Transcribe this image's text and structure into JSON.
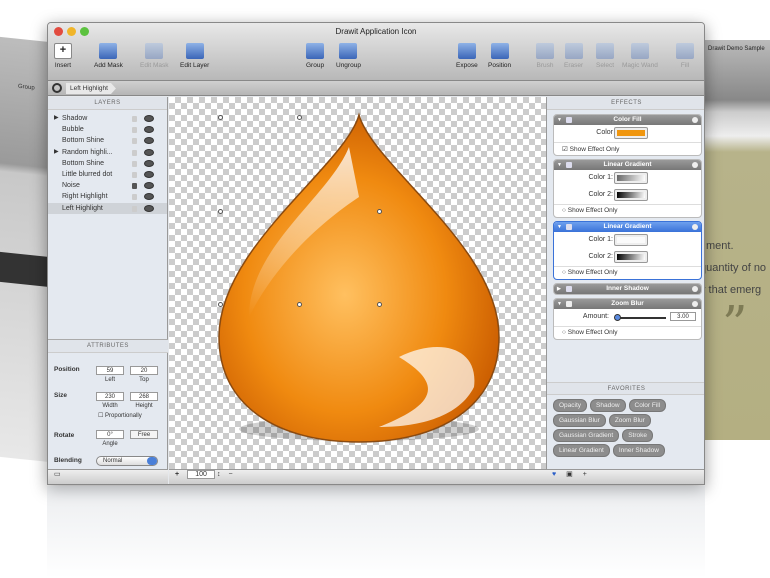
{
  "background_left": {
    "label": "Group"
  },
  "background_right": {
    "title": "Drawit Demo Sample",
    "lines": [
      "ment.",
      "quantity of no",
      "y that emerg"
    ],
    "quote": "”"
  },
  "window": {
    "title": "Drawit Application Icon"
  },
  "toolbar": [
    {
      "label": "Insert",
      "enabled": true
    },
    {
      "label": "Add Mask",
      "enabled": true
    },
    {
      "label": "Edit Mask",
      "enabled": false
    },
    {
      "label": "Edit Layer",
      "enabled": true
    },
    {
      "label": "Group",
      "enabled": true
    },
    {
      "label": "Ungroup",
      "enabled": true
    },
    {
      "label": "Expose",
      "enabled": true
    },
    {
      "label": "Position",
      "enabled": true
    },
    {
      "label": "Brush",
      "enabled": false
    },
    {
      "label": "Eraser",
      "enabled": false
    },
    {
      "label": "Select",
      "enabled": false
    },
    {
      "label": "Magic Wand",
      "enabled": false
    },
    {
      "label": "Fill",
      "enabled": false
    }
  ],
  "breadcrumb": "Left Highlight",
  "layers": {
    "title": "LAYERS",
    "items": [
      {
        "name": "Shadow",
        "group": true,
        "locked": false
      },
      {
        "name": "Bubble",
        "locked": false
      },
      {
        "name": "Bottom Shine",
        "locked": false
      },
      {
        "name": "Random highli...",
        "group": true,
        "locked": false
      },
      {
        "name": "Bottom Shine",
        "locked": false
      },
      {
        "name": "Little blurred dot",
        "locked": false
      },
      {
        "name": "Noise",
        "locked": true
      },
      {
        "name": "Right Highlight",
        "locked": false
      },
      {
        "name": "Left Highlight",
        "locked": false,
        "selected": true
      }
    ]
  },
  "attributes": {
    "title": "ATTRIBUTES",
    "position_label": "Position",
    "left": "59",
    "top": "20",
    "left_label": "Left",
    "top_label": "Top",
    "size_label": "Size",
    "width": "230",
    "height": "268",
    "width_label": "Width",
    "height_label": "Height",
    "proportionally": "Proportionally",
    "rotate_label": "Rotate",
    "angle": "0°",
    "free": "Free",
    "angle_label": "Angle",
    "blending_label": "Blending",
    "blending": "Normal"
  },
  "canvas": {
    "zoom": "100",
    "plus": "+",
    "minus": "−",
    "stepper": "↕",
    "fill_color": "#f08a10"
  },
  "effects": {
    "title": "EFFECTS",
    "show_effect_only": "Show Effect Only",
    "color1": "Color 1:",
    "color2": "Color 2:",
    "color": "Color",
    "color_fill": {
      "title": "Color Fill",
      "color": "#f0960f",
      "show": true
    },
    "linear1": {
      "title": "Linear Gradient"
    },
    "linear2": {
      "title": "Linear Gradient"
    },
    "inner_shadow": {
      "title": "Inner Shadow"
    },
    "zoom_blur": {
      "title": "Zoom Blur",
      "amount_label": "Amount:",
      "amount": "3.00"
    }
  },
  "favorites": {
    "title": "FAVORITES",
    "items": [
      "Opacity",
      "Shadow",
      "Color Fill",
      "Gaussian Blur",
      "Zoom Blur",
      "Gaussian Gradient",
      "Stroke",
      "Linear Gradient",
      "Inner Shadow"
    ]
  },
  "right_bottom": {
    "add": "+"
  }
}
